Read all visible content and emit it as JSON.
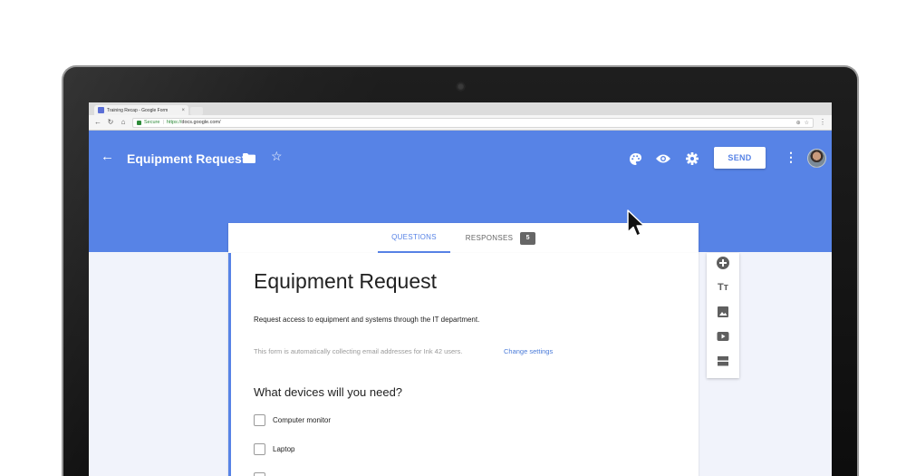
{
  "browser": {
    "tab_title": "Training Recap - Google Form",
    "tab_close": "×",
    "secure_label": "Secure",
    "url_scheme": "https://",
    "url_host": "docs.google.com/"
  },
  "header": {
    "title": "Equipment Request",
    "send_label": "SEND",
    "accent_color": "#5783e6"
  },
  "tabs": {
    "questions_label": "QUESTIONS",
    "responses_label": "RESPONSES",
    "responses_count": "5"
  },
  "form": {
    "title": "Equipment Request",
    "description": "Request access to equipment and systems through the IT department.",
    "email_note": "This form is automatically collecting email addresses for Ink 42 users.",
    "change_settings_label": "Change settings",
    "question": {
      "title": "What devices will you need?",
      "options": [
        "Computer monitor",
        "Laptop"
      ]
    }
  },
  "icons": {
    "back": "arrow-left-icon",
    "folder": "folder-icon",
    "star": "star-icon",
    "palette": "palette-icon",
    "preview": "eye-icon",
    "settings": "gear-icon",
    "more": "more-vert-icon",
    "add_question": "add-circle-icon",
    "add_title": "text-title-icon",
    "add_image": "image-icon",
    "add_video": "video-icon",
    "add_section": "section-icon"
  }
}
